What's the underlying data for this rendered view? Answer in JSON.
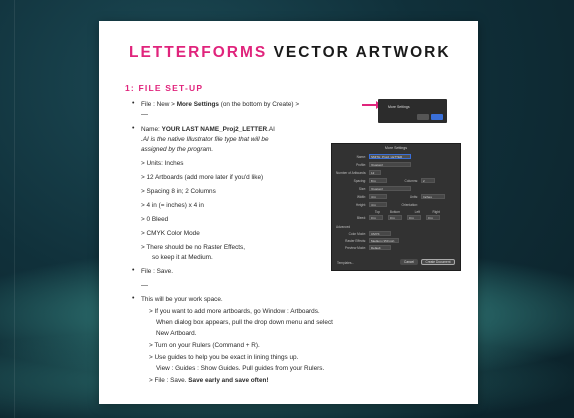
{
  "title": {
    "part1": "LETTERFORMS",
    "part2": "VECTOR ARTWORK"
  },
  "section": "1: FILE SET-UP",
  "lines": {
    "l1a": "File : New > ",
    "l1b": "More Settings",
    "l1c": " (on the bottom by Create) >",
    "l2a": "Name: ",
    "l2b": "YOUR LAST NAME_Proj2_LETTER",
    "l2c": ".AI",
    "l3": ".AI is the native Illustrator file type that will be",
    "l4": "assigned by the program.",
    "l5": "> Units: Inches",
    "l6": "> 12 Artboards (add more later if you'd like)",
    "l7": "> Spacing 8 in;  2 Columns",
    "l8": "> 4 in (= inches) x 4 in",
    "l9": "> 0 Bleed",
    "l10": "> CMYK Color Mode",
    "l11": "> There should be no Raster Effects,",
    "l12": "so keep it at Medium.",
    "l13": "File : Save.",
    "l14": "This will be your work space.",
    "l15": "> If you want to add more artboards, go Window : Artboards.",
    "l16": "When dialog box appears, pull the drop down menu and select",
    "l17": "New Artboard.",
    "l18": "> Turn on your Rulers (Command + R).",
    "l19": "> Use guides to help you be exact in lining things up.",
    "l20": "View : Guides : Show Guides. Pull guides from your Rulers.",
    "l21a": "> File : Save. ",
    "l21b": "Save early and save often!"
  },
  "thumb": {
    "label": "More Settings"
  },
  "dialog": {
    "title": "More Settings",
    "rows": [
      {
        "label": "Name:",
        "value": "SMITH_Proj2_LETTER"
      },
      {
        "label": "Profile:",
        "value": "[Custom]"
      },
      {
        "label": "Number of Artboards:",
        "value": "12"
      },
      {
        "label": "Spacing:",
        "value": "8 in"
      },
      {
        "label": "Size:",
        "value": "[Custom]"
      },
      {
        "label": "Width:",
        "value": "4 in"
      },
      {
        "label": "Height:",
        "value": "4 in"
      },
      {
        "label": "Bleed:",
        "value": "0 in"
      },
      {
        "label": "Color Mode:",
        "value": "CMYK"
      },
      {
        "label": "Raster Effects:",
        "value": "Medium (150 ppi)"
      },
      {
        "label": "Preview Mode:",
        "value": "Default"
      }
    ],
    "columns_label": "Columns:",
    "columns_value": "2",
    "units_label": "Units:",
    "units_value": "Inches",
    "orientation_label": "Orientation:",
    "bleed_headers": [
      "Top",
      "Bottom",
      "Left",
      "Right"
    ],
    "advanced": "Advanced",
    "templates_btn": "Templates...",
    "cancel_btn": "Cancel",
    "create_btn": "Create Document"
  }
}
